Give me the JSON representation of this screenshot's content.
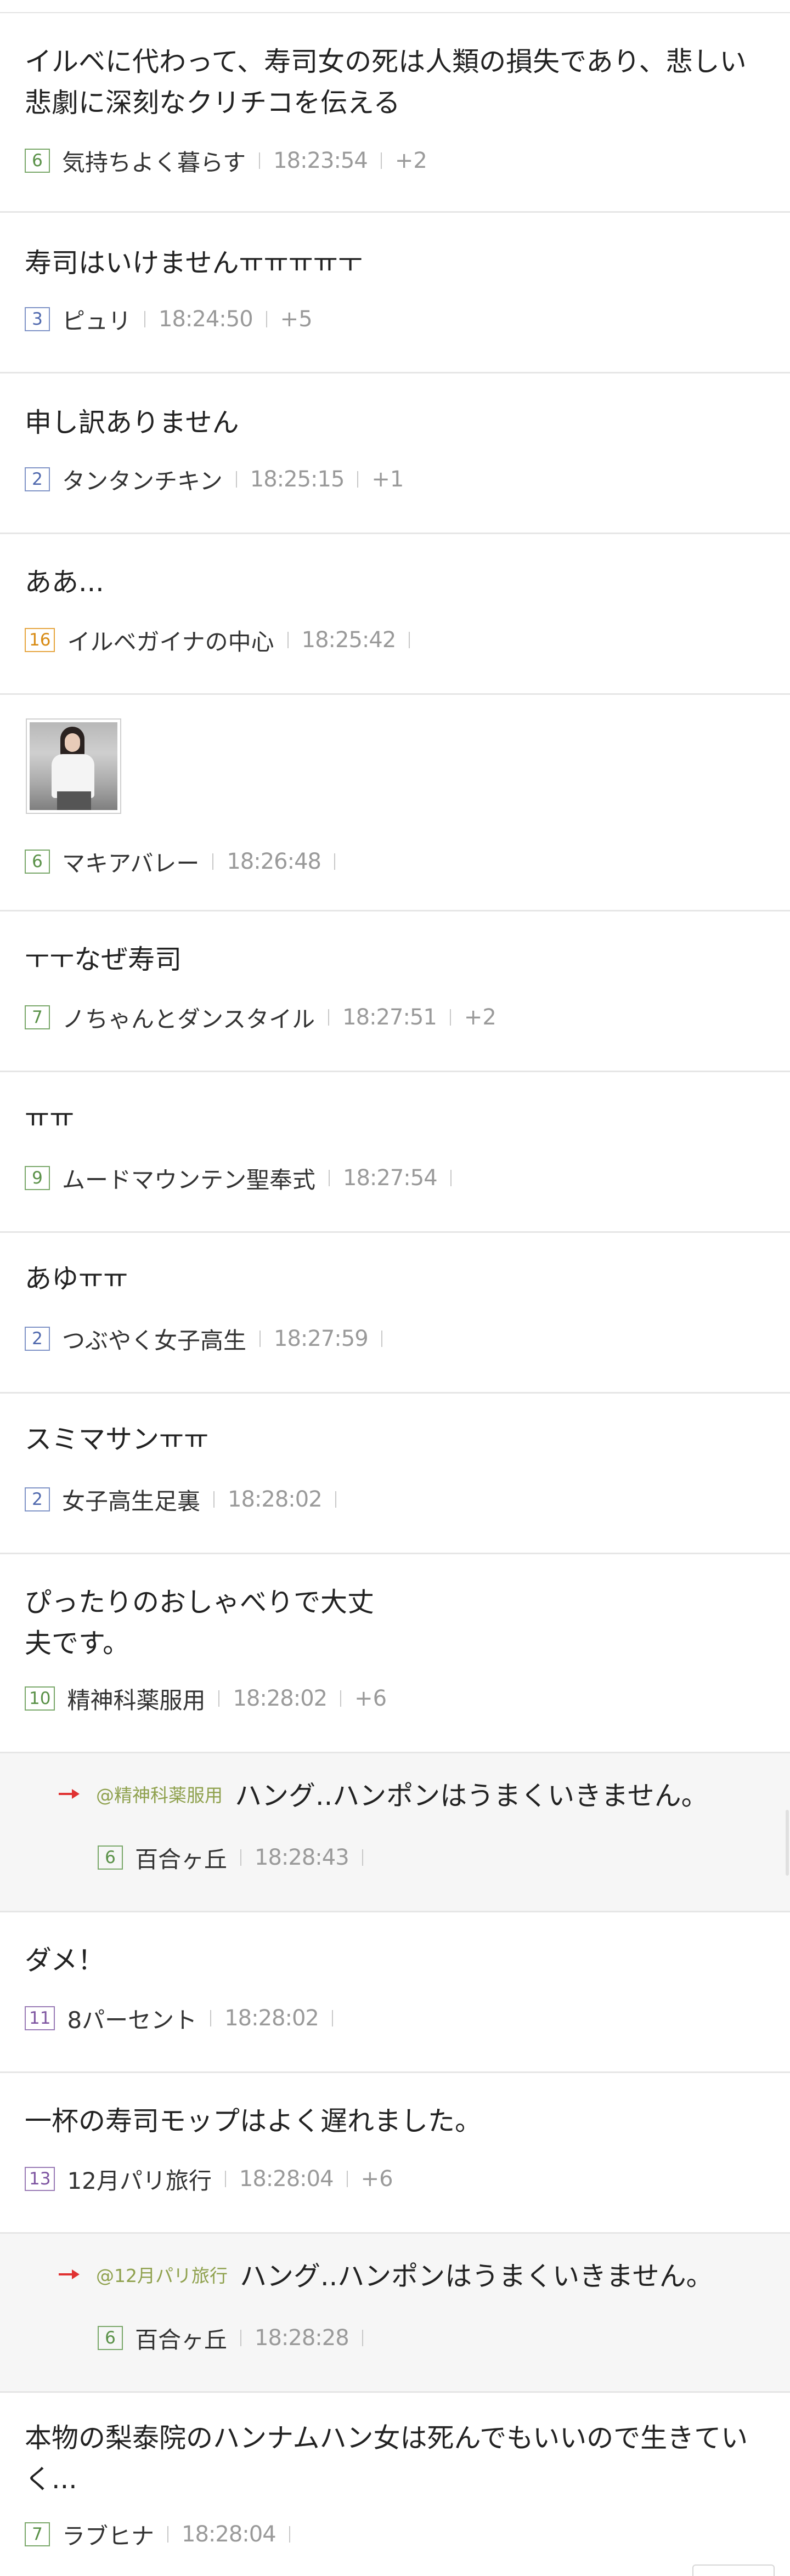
{
  "comments": [
    {
      "text": "イルベに代わって、寿司女の死は人類の損失であり、悲しい悲劇に深刻なクリチコを伝える",
      "level": "6",
      "nick": "気持ちよく暮らす",
      "time": "18:23:54",
      "extra": "+2"
    },
    {
      "text": "寿司はいけませんㅠㅠㅠㅠㅜ",
      "level": "3",
      "nick": "ピュリ",
      "time": "18:24:50",
      "extra": "+5"
    },
    {
      "text": "申し訳ありません",
      "level": "2",
      "nick": "タンタンチキン",
      "time": "18:25:15",
      "extra": "+1"
    },
    {
      "text": "ああ...",
      "level": "16",
      "nick": "イルベガイナの中心",
      "time": "18:25:42",
      "extra": ""
    },
    {
      "text": "",
      "level": "6",
      "nick": "マキアバレー",
      "time": "18:26:48",
      "extra": ""
    },
    {
      "text": "ㅜㅜなぜ寿司",
      "level": "7",
      "nick": "ノちゃんとダンスタイル",
      "time": "18:27:51",
      "extra": "+2"
    },
    {
      "text": "ㅠㅠ",
      "level": "9",
      "nick": "ムードマウンテン聖奉式",
      "time": "18:27:54",
      "extra": ""
    },
    {
      "text": "あゆㅠㅠ",
      "level": "2",
      "nick": "つぶやく女子高生",
      "time": "18:27:59",
      "extra": ""
    },
    {
      "text": "スミマサンㅠㅠ",
      "level": "2",
      "nick": "女子高生足裏",
      "time": "18:28:02",
      "extra": ""
    },
    {
      "text": "ぴったりのおしゃべりで大丈夫です。",
      "level": "10",
      "nick": "精神科薬服用",
      "time": "18:28:02",
      "extra": "+6"
    },
    {
      "mention": "@精神科薬服用",
      "text": "ハング..ハンポンはうまくいきません。",
      "level": "6",
      "nick": "百合ヶ丘",
      "time": "18:28:43",
      "extra": ""
    },
    {
      "text": "ダメ！",
      "level": "11",
      "nick": "8パーセント",
      "time": "18:28:02",
      "extra": ""
    },
    {
      "text": "一杯の寿司モップはよく遅れました。",
      "level": "13",
      "nick": "12月パリ旅行",
      "time": "18:28:04",
      "extra": "+6"
    },
    {
      "mention": "@12月パリ旅行",
      "text": "ハング..ハンポンはうまくいきません。",
      "level": "6",
      "nick": "百合ヶ丘",
      "time": "18:28:28",
      "extra": ""
    },
    {
      "text": "本物の梨泰院のハンナムハン女は死んでもいいので生きていく...",
      "level": "7",
      "nick": "ラブヒナ",
      "time": "18:28:04",
      "extra": ""
    }
  ],
  "colors": {
    "reply_arrow": "#e03131",
    "mention": "#8fa14e",
    "separator": "#e6e6e6",
    "reply_bg": "#f6f6f6"
  },
  "icons": {
    "reply": "reply-arrow-icon",
    "image": "photo-thumbnail"
  }
}
